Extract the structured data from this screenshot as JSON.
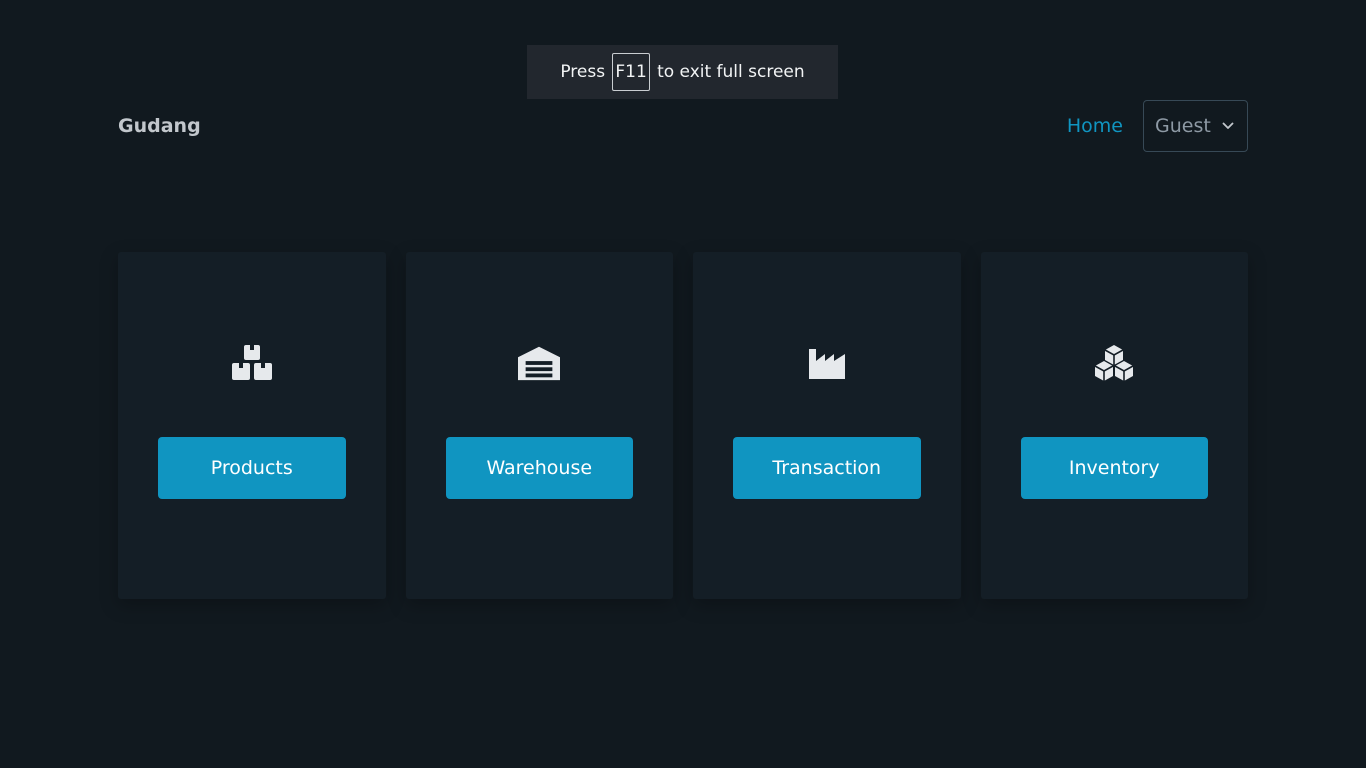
{
  "fullscreen_notice": {
    "prefix": "Press",
    "key": "F11",
    "suffix": "to exit full screen"
  },
  "nav": {
    "brand": "Gudang",
    "home_label": "Home",
    "user_select": {
      "value": "Guest",
      "icon": "chevron-down-icon"
    }
  },
  "cards": [
    {
      "icon": "boxes-icon",
      "button_label": "Products"
    },
    {
      "icon": "warehouse-icon",
      "button_label": "Warehouse"
    },
    {
      "icon": "industry-icon",
      "button_label": "Transaction"
    },
    {
      "icon": "cubes-icon",
      "button_label": "Inventory"
    }
  ],
  "colors": {
    "background": "#11191f",
    "card": "#141e26",
    "accent": "#1095c1",
    "icon": "#e6e9ec"
  }
}
